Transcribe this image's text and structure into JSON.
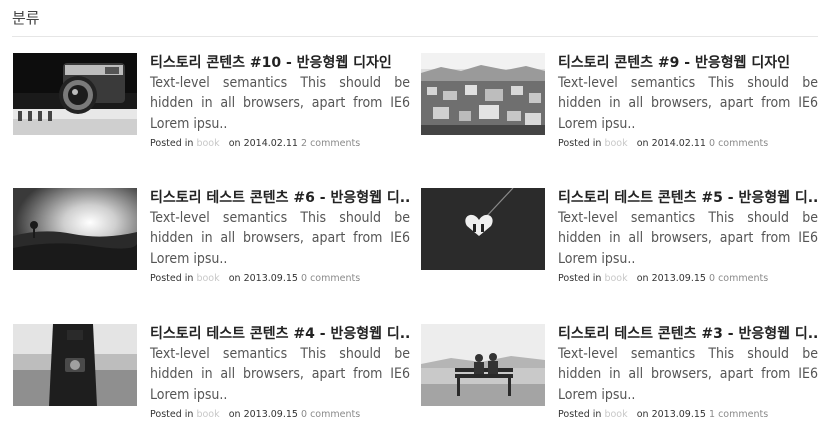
{
  "header": {
    "title": "분류"
  },
  "posts": [
    {
      "title": "티스토리 콘텐츠 #10 - 반응형웹 디자인",
      "excerpt": "Text-level semantics This should be hidden in all browsers, apart from IE6 Lorem ipsu..",
      "posted_in": "Posted in",
      "category": "book",
      "on": "on",
      "date": "2014.02.11",
      "comments": "2 comments",
      "thumb_icon": "camera-photo"
    },
    {
      "title": "티스토리 콘텐츠 #9 - 반응형웹 디자인",
      "excerpt": "Text-level semantics This should be hidden in all browsers, apart from IE6 Lorem ipsu..",
      "posted_in": "Posted in",
      "category": "book",
      "on": "on",
      "date": "2014.02.11",
      "comments": "0 comments",
      "thumb_icon": "city-photo"
    },
    {
      "title": "티스토리 테스트 콘텐츠 #6 - 반응형웹 디..",
      "excerpt": "Text-level semantics This should be hidden in all browsers, apart from IE6 Lorem ipsu..",
      "posted_in": "Posted in",
      "category": "book",
      "on": "on",
      "date": "2013.09.15",
      "comments": "0 comments",
      "thumb_icon": "sunset-landscape-photo"
    },
    {
      "title": "티스토리 테스트 콘텐츠 #5 - 반응형웹 디..",
      "excerpt": "Text-level semantics This should be hidden in all browsers, apart from IE6 Lorem ipsu..",
      "posted_in": "Posted in",
      "category": "book",
      "on": "on",
      "date": "2013.09.15",
      "comments": "0 comments",
      "thumb_icon": "heart-pendant-photo"
    },
    {
      "title": "티스토리 테스트 콘텐츠 #4 - 반응형웹 디..",
      "excerpt": "Text-level semantics This should be hidden in all browsers, apart from IE6 Lorem ipsu..",
      "posted_in": "Posted in",
      "category": "book",
      "on": "on",
      "date": "2013.09.15",
      "comments": "0 comments",
      "thumb_icon": "photographer-photo"
    },
    {
      "title": "티스토리 테스트 콘텐츠 #3 - 반응형웹 디..",
      "excerpt": "Text-level semantics This should be hidden in all browsers, apart from IE6 Lorem ipsu..",
      "posted_in": "Posted in",
      "category": "book",
      "on": "on",
      "date": "2013.09.15",
      "comments": "1 comments",
      "thumb_icon": "bench-couple-photo"
    }
  ]
}
